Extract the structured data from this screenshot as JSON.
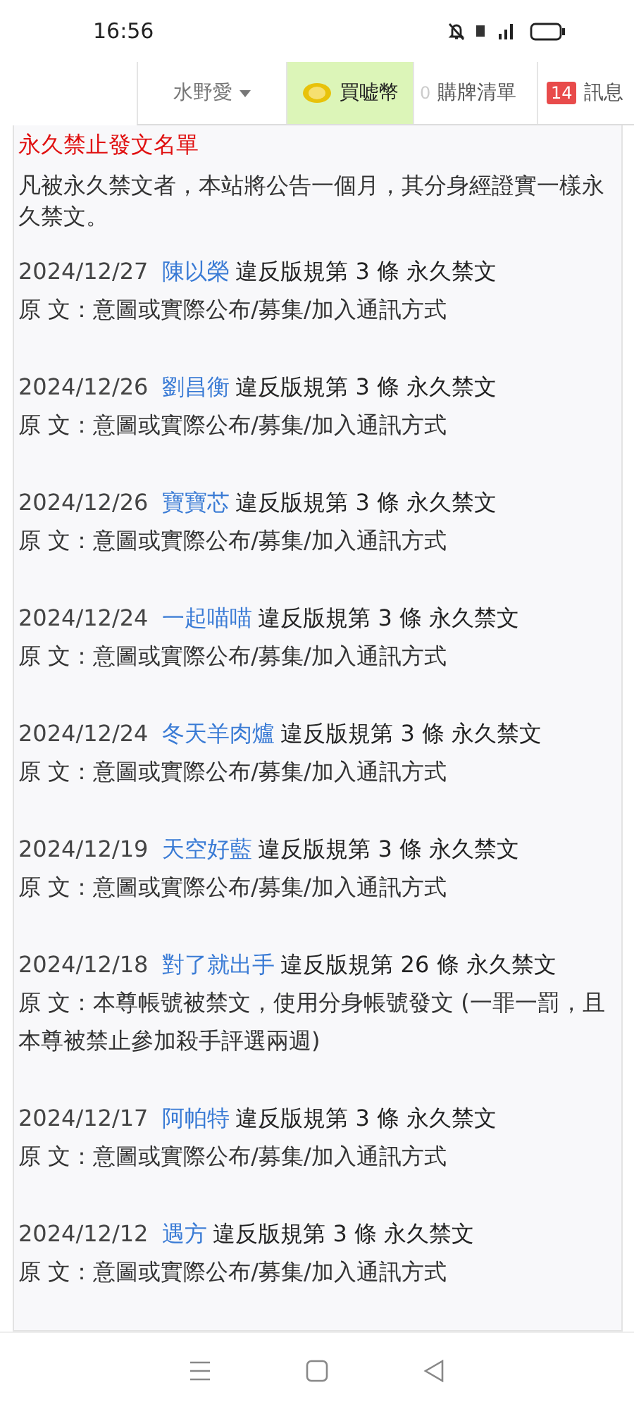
{
  "status_bar": {
    "time": "16:56"
  },
  "nav": {
    "user": "水野愛",
    "coin": "買嘘幣",
    "cart_count": "0",
    "cart": "購牌清單",
    "msg_count": "14",
    "messages": "訊息"
  },
  "title": "永久禁止發文名單",
  "notice": "凡被永久禁文者，本站將公告一個月，其分身經證實一樣永久禁文。",
  "entries": [
    {
      "date": "2024/12/27",
      "user": "陳以榮",
      "rule": "違反版規第 3 條 永久禁文",
      "label": "原 文：",
      "reason": "意圖或實際公布/募集/加入通訊方式"
    },
    {
      "date": "2024/12/26",
      "user": "劉昌衡",
      "rule": "違反版規第 3 條 永久禁文",
      "label": "原 文：",
      "reason": "意圖或實際公布/募集/加入通訊方式"
    },
    {
      "date": "2024/12/26",
      "user": "寶寶芯",
      "rule": "違反版規第 3 條 永久禁文",
      "label": "原 文：",
      "reason": "意圖或實際公布/募集/加入通訊方式"
    },
    {
      "date": "2024/12/24",
      "user": "一起喵喵",
      "rule": "違反版規第 3 條 永久禁文",
      "label": "原 文：",
      "reason": "意圖或實際公布/募集/加入通訊方式"
    },
    {
      "date": "2024/12/24",
      "user": "冬天羊肉爐",
      "rule": "違反版規第 3 條 永久禁文",
      "label": "原 文：",
      "reason": "意圖或實際公布/募集/加入通訊方式"
    },
    {
      "date": "2024/12/19",
      "user": "天空好藍",
      "rule": "違反版規第 3 條 永久禁文",
      "label": "原 文：",
      "reason": "意圖或實際公布/募集/加入通訊方式"
    },
    {
      "date": "2024/12/18",
      "user": "對了就出手",
      "rule": "違反版規第 26 條 永久禁文",
      "label": "原 文：",
      "reason": "本尊帳號被禁文，使用分身帳號發文 (一罪一罰，且本尊被禁止參加殺手評選兩週)"
    },
    {
      "date": "2024/12/17",
      "user": "阿帕特",
      "rule": "違反版規第 3 條 永久禁文",
      "label": "原 文：",
      "reason": "意圖或實際公布/募集/加入通訊方式"
    },
    {
      "date": "2024/12/12",
      "user": "遇方",
      "rule": "違反版規第 3 條 永久禁文",
      "label": "原 文：",
      "reason": "意圖或實際公布/募集/加入通訊方式"
    }
  ]
}
